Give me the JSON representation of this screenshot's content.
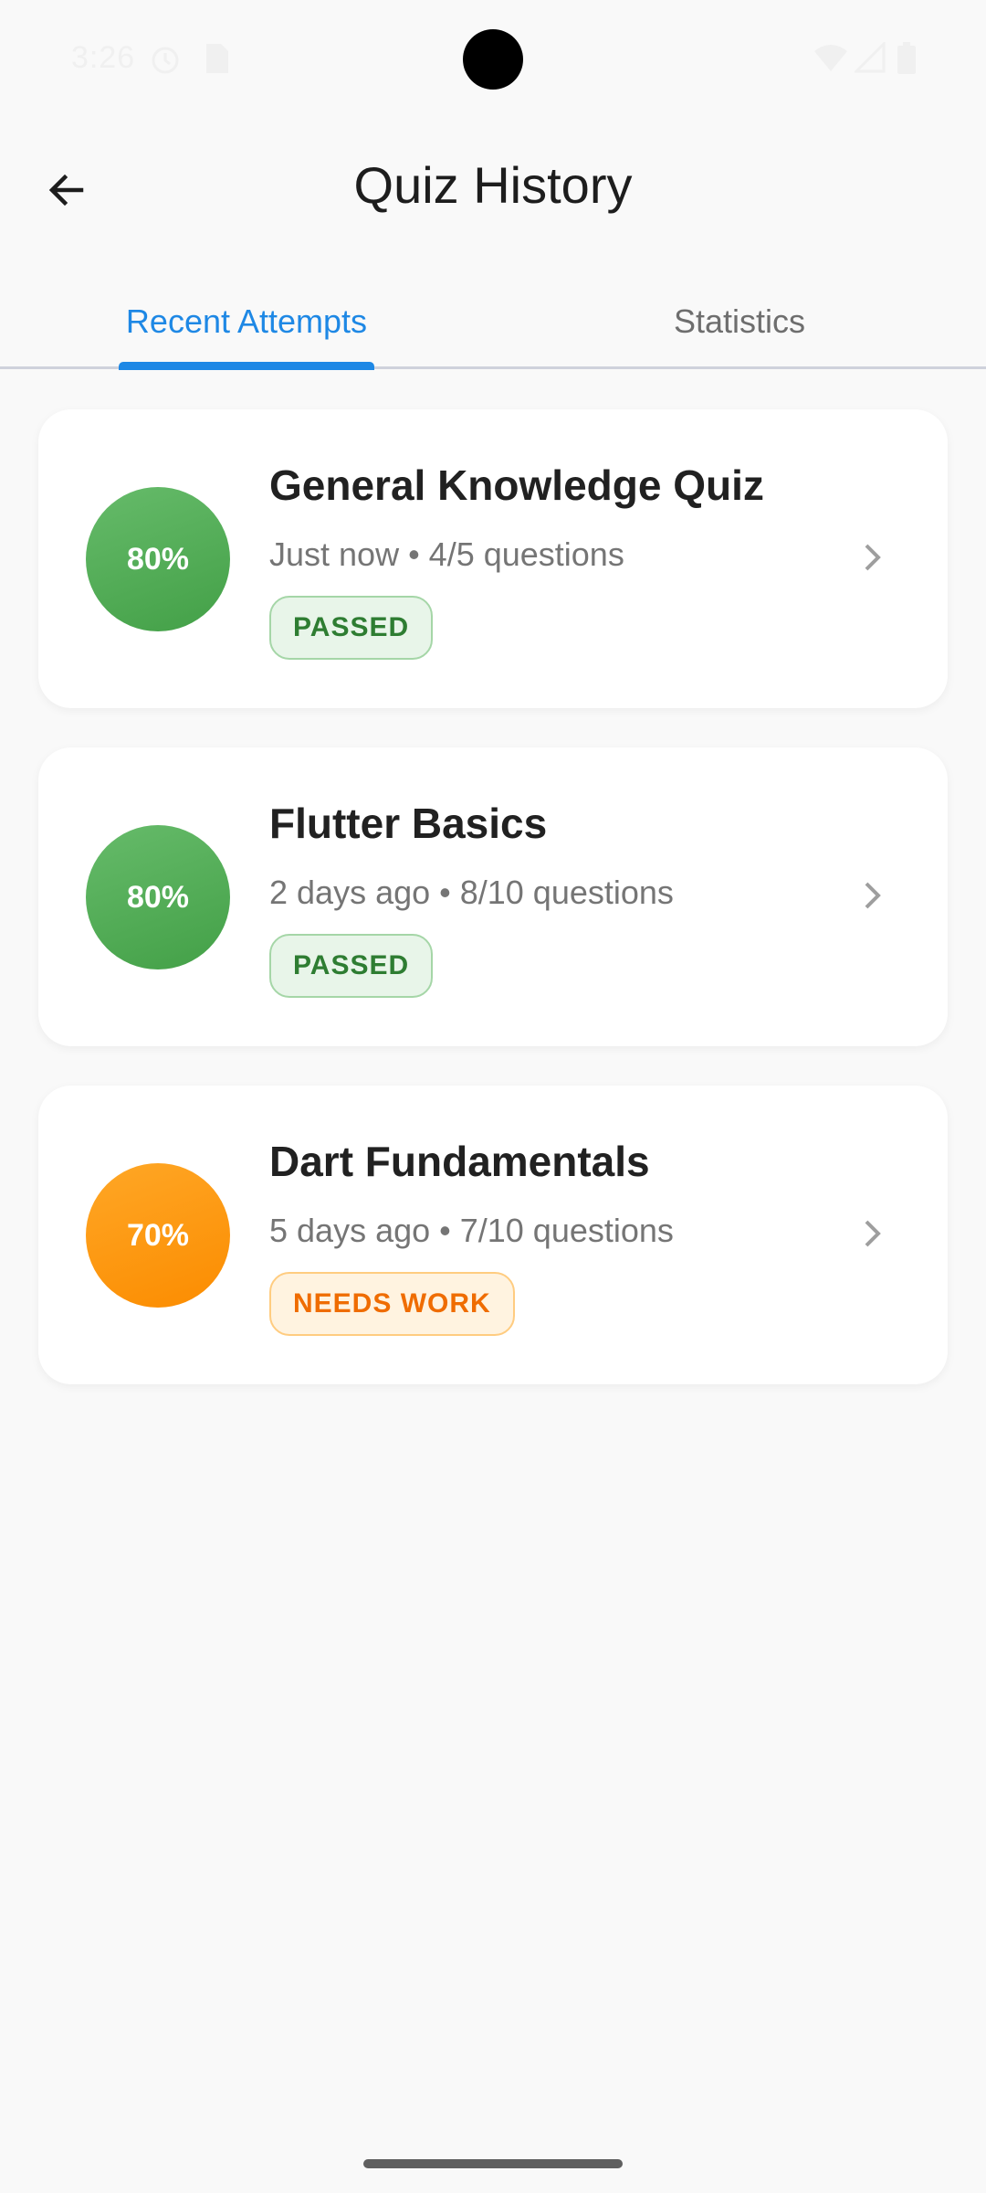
{
  "status_bar": {
    "time": "3:26",
    "icons": [
      "alarm-icon",
      "sim-card-icon",
      "wifi-icon",
      "signal-icon",
      "battery-icon"
    ]
  },
  "app_bar": {
    "title": "Quiz History",
    "back_icon": "arrow-left-icon"
  },
  "tabs": [
    {
      "label": "Recent Attempts",
      "selected": true
    },
    {
      "label": "Statistics",
      "selected": false
    }
  ],
  "attempts": [
    {
      "score": "80%",
      "title": "General Knowledge Quiz",
      "meta": "Just now • 4/5 questions",
      "status": "PASSED",
      "color": "#4caf50"
    },
    {
      "score": "80%",
      "title": "Flutter Basics",
      "meta": "2 days ago • 8/10 questions",
      "status": "PASSED",
      "color": "#4caf50"
    },
    {
      "score": "70%",
      "title": "Dart Fundamentals",
      "meta": "5 days ago • 7/10 questions",
      "status": "NEEDS WORK",
      "color": "#fb8c00"
    }
  ],
  "colors": {
    "accent": "#1e88e5",
    "passed": "#2e7d32",
    "needs_work": "#ef6c00",
    "background": "#f9f9f9"
  }
}
